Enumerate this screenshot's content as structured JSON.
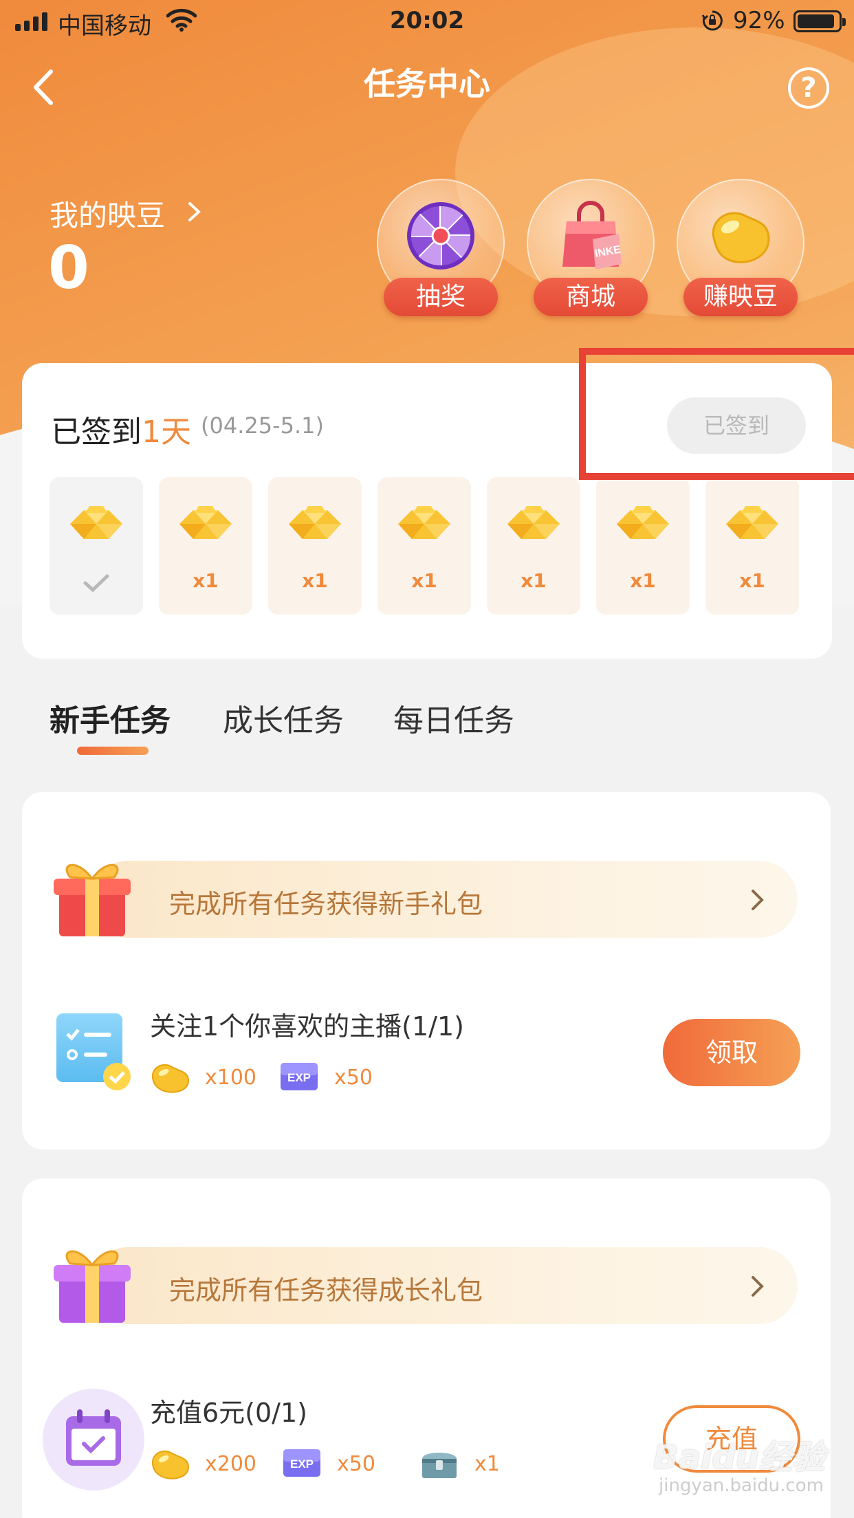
{
  "status_bar": {
    "carrier": "中国移动",
    "time": "20:02",
    "battery": "92%",
    "battery_level": 0.92
  },
  "nav": {
    "title": "任务中心",
    "help_symbol": "?"
  },
  "beans": {
    "label": "我的映豆",
    "count": "0"
  },
  "features": [
    {
      "label": "抽奖",
      "icon": "lottery-wheel-icon"
    },
    {
      "label": "商城",
      "icon": "shop-bag-icon"
    },
    {
      "label": "赚映豆",
      "icon": "bean-icon"
    }
  ],
  "checkin": {
    "title_prefix": "已签到",
    "days_count": "1天",
    "date_range": "(04.25-5.1)",
    "button": "已签到",
    "days": [
      {
        "status": "done",
        "qty": ""
      },
      {
        "status": "pending",
        "qty": "x1"
      },
      {
        "status": "pending",
        "qty": "x1"
      },
      {
        "status": "pending",
        "qty": "x1"
      },
      {
        "status": "pending",
        "qty": "x1"
      },
      {
        "status": "pending",
        "qty": "x1"
      },
      {
        "status": "pending",
        "qty": "x1"
      }
    ]
  },
  "tabs": [
    {
      "label": "新手任务",
      "active": true
    },
    {
      "label": "成长任务",
      "active": false
    },
    {
      "label": "每日任务",
      "active": false
    }
  ],
  "newbie": {
    "banner": "完成所有任务获得新手礼包",
    "task": {
      "title": "关注1个你喜欢的主播(1/1)",
      "rewards": [
        {
          "icon": "bean-icon",
          "qty": "x100"
        },
        {
          "icon": "exp-icon",
          "label": "EXP",
          "qty": "x50"
        }
      ],
      "button": "领取"
    }
  },
  "growth": {
    "banner": "完成所有任务获得成长礼包",
    "task": {
      "title": "充值6元(0/1)",
      "rewards": [
        {
          "icon": "bean-icon",
          "qty": "x200"
        },
        {
          "icon": "exp-icon",
          "label": "EXP",
          "qty": "x50"
        },
        {
          "icon": "treasure-chest-icon",
          "qty": "x1"
        }
      ],
      "button": "充值"
    }
  },
  "watermark": {
    "brand": "Baidu经验",
    "url": "jingyan.baidu.com"
  },
  "colors": {
    "accent": "#f08a3c",
    "highlight_box": "#e84136"
  }
}
